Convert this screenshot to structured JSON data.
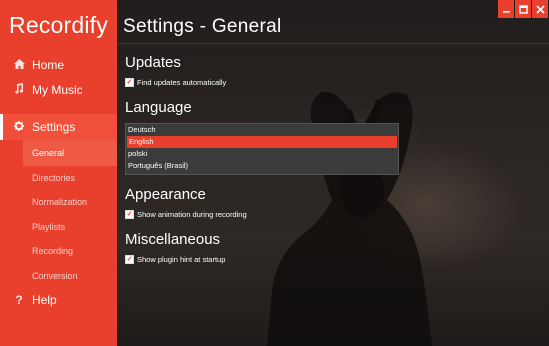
{
  "app": {
    "name": "Recordify"
  },
  "sidebar": {
    "home": {
      "label": "Home",
      "icon": "home-icon"
    },
    "music": {
      "label": "My Music",
      "icon": "music-note-icon"
    },
    "settings": {
      "label": "Settings",
      "icon": "gear-icon"
    },
    "help": {
      "label": "Help",
      "icon": "question-icon"
    },
    "sub_items": [
      "General",
      "Directories",
      "Normalization",
      "Playlists",
      "Recording",
      "Conversion"
    ]
  },
  "page": {
    "title": "Settings - General"
  },
  "updates": {
    "heading": "Updates",
    "find_updates_label": "Find updates automatically",
    "find_updates_checked": true
  },
  "language": {
    "heading": "Language",
    "options": [
      "Deutsch",
      "English",
      "polski",
      "Português (Brasil)"
    ],
    "selected": "English"
  },
  "appearance": {
    "heading": "Appearance",
    "animation_label": "Show animation during recording",
    "animation_checked": true
  },
  "misc": {
    "heading": "Miscellaneous",
    "plugin_hint_label": "Show plugin hint at startup",
    "plugin_hint_checked": true
  },
  "window_controls": [
    "minimize-icon",
    "maximize-icon",
    "close-icon"
  ],
  "colors": {
    "accent": "#e8402c",
    "background": "#1a1716",
    "list_bg": "#3b3b3b"
  }
}
